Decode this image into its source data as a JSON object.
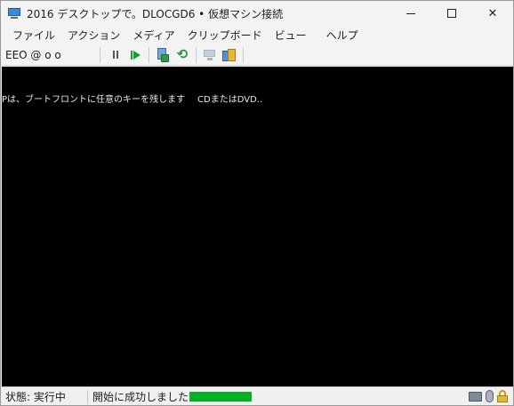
{
  "window": {
    "title": "2016 デスクトップで。DLOCGD6 • 仮想マシン接続",
    "controls": {
      "minimize": "",
      "maximize": "",
      "close": "✕"
    }
  },
  "menu": {
    "items": [
      "ファイル",
      "アクション",
      "メディア",
      "クリップボード",
      "ビュー",
      "ヘルプ"
    ]
  },
  "toolbar": {
    "vm_name": "EEO @ o o",
    "icons": [
      "pause-icon",
      "resume-icon",
      "snapshot-icon",
      "revert-icon",
      "network-icon",
      "share-icon"
    ]
  },
  "console": {
    "text_left": "Pは、ブートフロントに任意のキーを残します",
    "text_right": "CDまたはDVD.."
  },
  "status": {
    "state": "状態: 実行中",
    "message": "開始に成功しました",
    "progress": 1.0,
    "progress_color": "#06b025"
  },
  "colors": {
    "console_bg": "#000000",
    "window_bg": "#f3f3f3"
  }
}
